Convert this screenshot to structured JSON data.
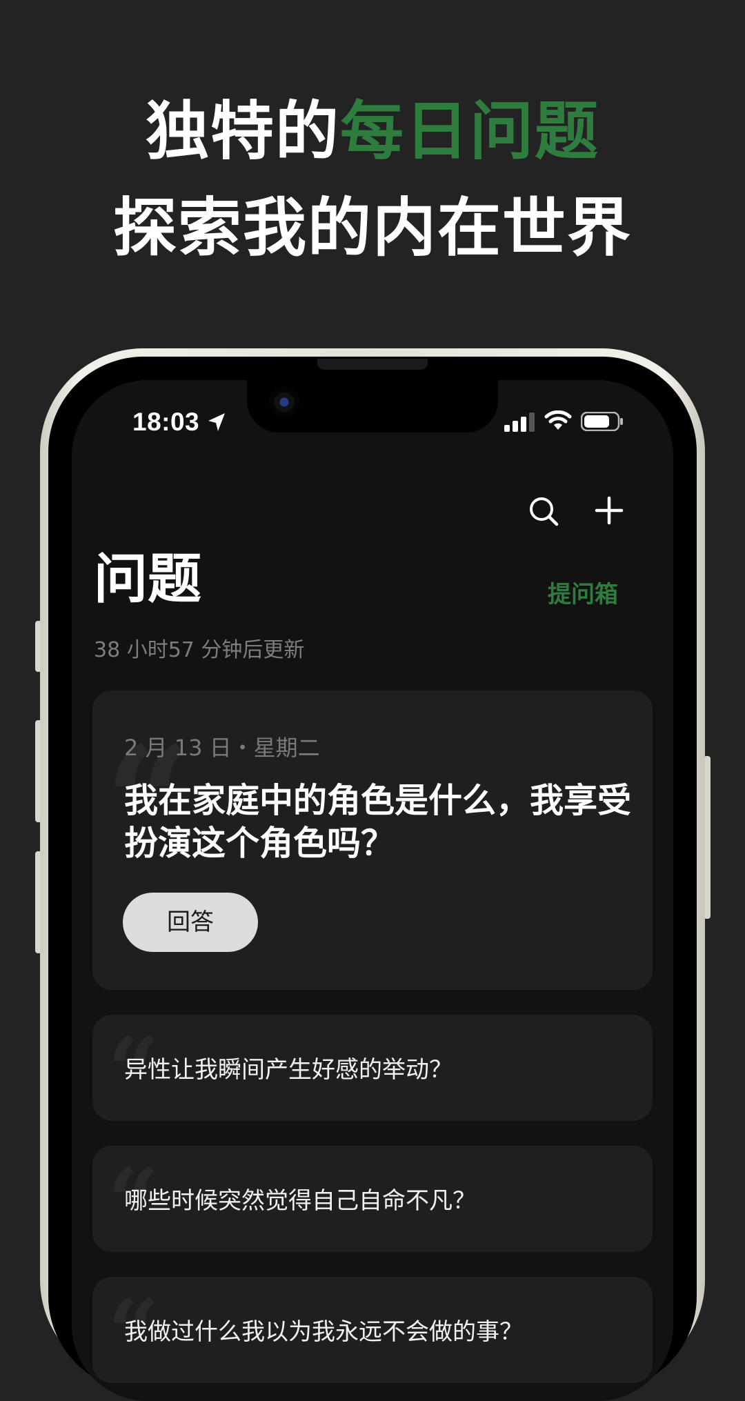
{
  "headline": {
    "line1_prefix": "独特的",
    "line1_accent": "每日问题",
    "line2": "探索我的内在世界"
  },
  "status_bar": {
    "time": "18:03",
    "icons": [
      "location-arrow-icon",
      "cellular-signal-icon",
      "wifi-icon",
      "battery-icon"
    ]
  },
  "toolbar": {
    "icons": [
      "search-icon",
      "plus-icon"
    ]
  },
  "page": {
    "title": "问题",
    "inbox_label": "提问箱",
    "update_text": "38 小时57 分钟后更新"
  },
  "daily_card": {
    "date": "2 月 13 日・星期二",
    "question": "我在家庭中的角色是什么，我享受扮演这个角色吗？",
    "answer_label": "回答"
  },
  "questions": [
    {
      "text": "异性让我瞬间产生好感的举动？"
    },
    {
      "text": "哪些时候突然觉得自己自命不凡？"
    },
    {
      "text": "我做过什么我以为我永远不会做的事？"
    }
  ],
  "colors": {
    "background": "#232323",
    "accent": "#2e7d3f",
    "card": "#1f1f21",
    "answer_button": "#dcdcde"
  }
}
